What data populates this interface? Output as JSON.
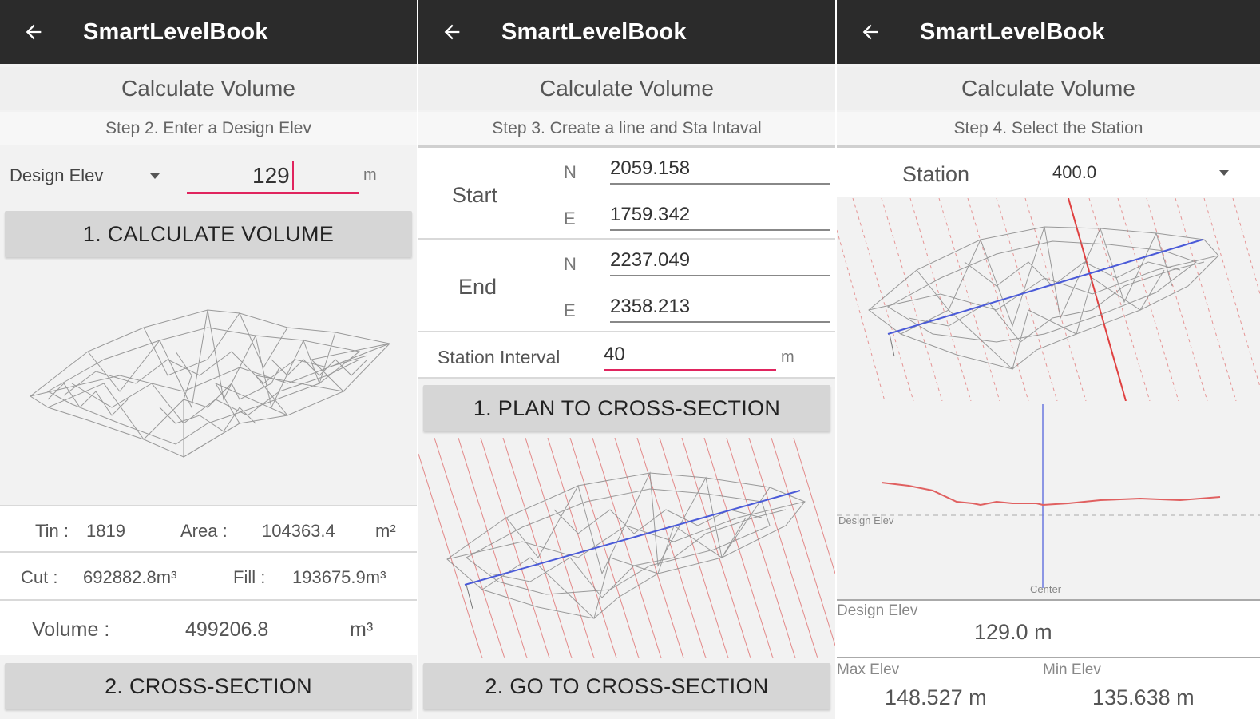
{
  "app_title": "SmartLevelBook",
  "screen_title": "Calculate Volume",
  "panels": {
    "p1": {
      "step": "Step 2. Enter a Design Elev",
      "design_elev_select": "Design Elev",
      "design_elev_value": "129",
      "unit_m": "m",
      "calc_button": "1. CALCULATE VOLUME",
      "tin_label": "Tin :",
      "tin_value": "1819",
      "area_label": "Area :",
      "area_value": "104363.4",
      "area_unit": "m²",
      "cut_label": "Cut :",
      "cut_value": "692882.8m³",
      "fill_label": "Fill :",
      "fill_value": "193675.9m³",
      "volume_label": "Volume :",
      "volume_value": "499206.8",
      "volume_unit": "m³",
      "cross_button": "2. CROSS-SECTION"
    },
    "p2": {
      "step": "Step 3. Create a line and Sta Intaval",
      "start_label": "Start",
      "end_label": "End",
      "n_label": "N",
      "e_label": "E",
      "start_n": "2059.158",
      "start_e": "1759.342",
      "end_n": "2237.049",
      "end_e": "2358.213",
      "interval_label": "Station Interval",
      "interval_value": "40",
      "unit_m": "m",
      "plan_button": "1. PLAN TO CROSS-SECTION",
      "goto_button": "2. GO TO CROSS-SECTION"
    },
    "p3": {
      "step": "Step 4. Select the Station",
      "station_label": "Station",
      "station_value": "400.0",
      "design_elev_chart_label": "Design Elev",
      "center_label": "Center",
      "design_elev_label": "Design Elev",
      "design_elev_value": "129.0 m",
      "max_elev_label": "Max Elev",
      "max_elev_value": "148.527 m",
      "min_elev_label": "Min Elev",
      "min_elev_value": "135.638 m"
    }
  },
  "colors": {
    "appbar": "#2b2b2b",
    "accent_underline": "#e0245e",
    "station_line": "#e04040",
    "center_line": "#4a5ad8",
    "mesh": "#8a8a8a"
  },
  "icons": {
    "back": "arrow-left-icon",
    "dropdown": "triangle-down-icon"
  }
}
